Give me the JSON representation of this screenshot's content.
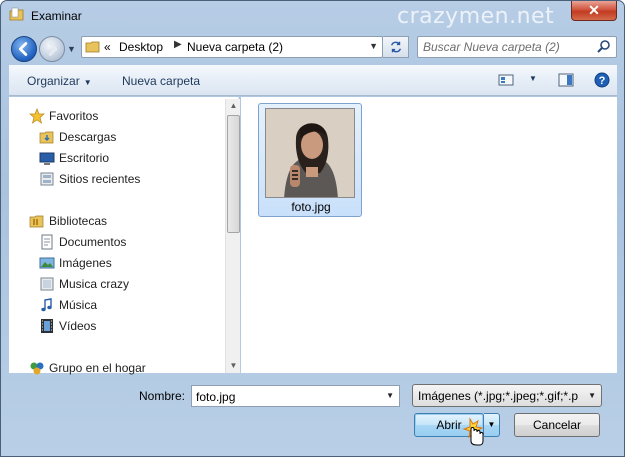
{
  "window": {
    "title": "Examinar",
    "watermark": "crazymen.net",
    "close_label": "✕"
  },
  "address": {
    "overflow": "«",
    "crumbs": [
      "Desktop",
      "Nueva carpeta (2)"
    ],
    "search_placeholder": "Buscar Nueva carpeta (2)"
  },
  "toolbar": {
    "organize_label": "Organizar",
    "new_folder_label": "Nueva carpeta"
  },
  "navpane": {
    "favorites": "Favoritos",
    "favorites_items": [
      "Descargas",
      "Escritorio",
      "Sitios recientes"
    ],
    "libraries": "Bibliotecas",
    "libraries_items": [
      "Documentos",
      "Imágenes",
      "Musica crazy",
      "Música",
      "Vídeos"
    ],
    "homegroup": "Grupo en el hogar"
  },
  "files": [
    {
      "name": "foto.jpg",
      "selected": true
    }
  ],
  "footer": {
    "name_label": "Nombre:",
    "name_value": "foto.jpg",
    "filetype_value": "Imágenes (*.jpg;*.jpeg;*.gif;*.pr",
    "open_label": "Abrir",
    "cancel_label": "Cancelar"
  },
  "colors": {
    "accent": "#3c7fb1",
    "selection": "#c9e0fb",
    "frame": "#b7cde6"
  }
}
